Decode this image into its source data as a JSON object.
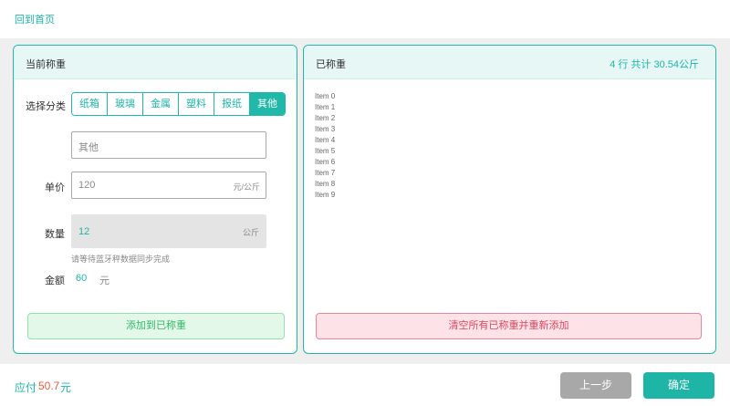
{
  "header": {
    "home_link": "回到首页"
  },
  "left_panel": {
    "title": "当前称重",
    "category_label": "选择分类",
    "categories": [
      {
        "label": "纸箱",
        "active": false
      },
      {
        "label": "玻璃",
        "active": false
      },
      {
        "label": "金属",
        "active": false
      },
      {
        "label": "塑料",
        "active": false
      },
      {
        "label": "报纸",
        "active": false
      },
      {
        "label": "其他",
        "active": true
      }
    ],
    "other_input": {
      "value": "其他"
    },
    "price": {
      "label": "单价",
      "value": "120",
      "unit": "元/公斤"
    },
    "quantity": {
      "label": "数量",
      "value": "12",
      "unit": "公斤",
      "hint": "请等待蓝牙秤数据同步完成"
    },
    "amount": {
      "label": "金额",
      "value": "60",
      "unit": "元"
    },
    "add_button": "添加到已称重"
  },
  "right_panel": {
    "title": "已称重",
    "summary": "4 行 共计 30.54公斤",
    "items": [
      "Item 0",
      "Item 1",
      "Item 2",
      "Item 3",
      "Item 4",
      "Item 5",
      "Item 6",
      "Item 7",
      "Item 8",
      "Item 9"
    ],
    "clear_button": "清空所有已称重并重新添加"
  },
  "footer": {
    "due_label": "应付",
    "due_value": "50.7",
    "due_unit": "元",
    "prev_button": "上一步",
    "confirm_button": "确定"
  },
  "colors": {
    "accent": "#1eb5a6",
    "due_amount": "#f05a3c",
    "add_button_text": "#34b86b",
    "clear_button_text": "#d8485f"
  }
}
